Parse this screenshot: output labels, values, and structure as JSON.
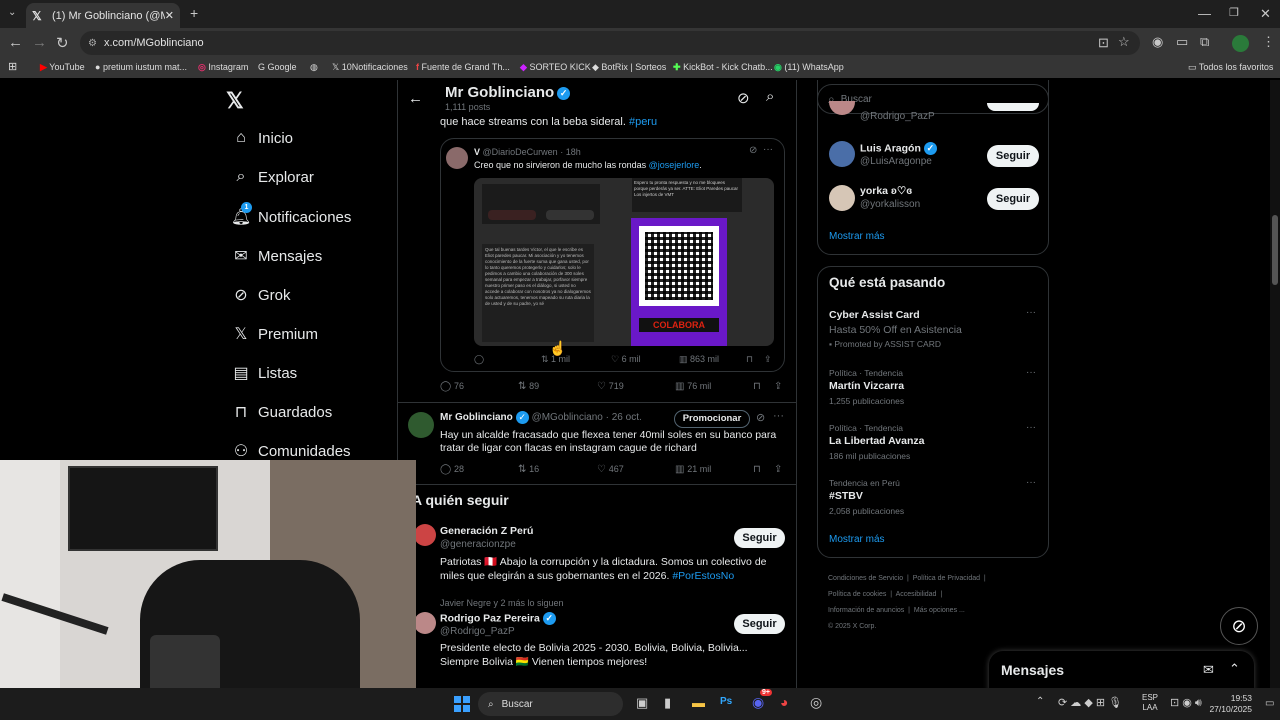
{
  "browser": {
    "tab_title": "(1) Mr Goblinciano (@MGoblinc",
    "url": "x.com/MGoblinciano",
    "bookmarks": [
      "YouTube",
      "pretium iustum mat...",
      "Instagram",
      "Google",
      "10Notificaciones",
      "Fuente de Grand Th...",
      "SORTEO KICK",
      "BotRix | Sorteos",
      "KickBot - Kick Chatb...",
      "(11) WhatsApp"
    ],
    "bookmarks_folder": "Todos los favoritos"
  },
  "nav": {
    "items": [
      "Inicio",
      "Explorar",
      "Notificaciones",
      "Mensajes",
      "Grok",
      "Premium",
      "Listas",
      "Guardados",
      "Comunidades"
    ],
    "notif_badge": "1"
  },
  "profile": {
    "name": "Mr Goblinciano",
    "posts": "1,111 posts"
  },
  "tweet1": {
    "text_tail": "que hace streams con la beba sideral.",
    "hashtag": "#peru",
    "quote": {
      "author": "V",
      "handle": "@DiarioDeCurwen",
      "time": "· 18h",
      "text": "Creo que no sirvieron de mucho las rondas",
      "mention": "@josejerlore",
      "text_end": ".",
      "image_label": "COLABORA",
      "image_note_left": "Que tal buenas tardes Victor, el que le escribe es Eliot paredes paucar. Mi asociación y yo tenemos conocimiento de la fuerte suma que gana usted, por lo tanto queremos protegerlo y cuidarlos; solo le pedimos a cambio una colaboración de 300 soles semanal para empezar a trabajar, porfavor siempre nuestro primer paso es el diálogo, si usted no accede a colaborar con nosotros ya no dialogaremos solo actuaremos, tenemos mapeado su ruta diaria la de usted y de su padre, yo sé",
      "image_note_right": "Espero tu pronta respuesta y no me bloquees porque perderás ya ser. ATTE: Eliot Paredes paucar Los injertos de VMT",
      "stats": {
        "replies": "",
        "retweets": "1 mil",
        "likes": "6 mil",
        "views": "863 mil"
      }
    },
    "stats": {
      "replies": "76",
      "retweets": "89",
      "likes": "719",
      "views": "76 mil"
    }
  },
  "tweet2": {
    "author": "Mr Goblinciano",
    "handle": "@MGoblinciano",
    "time": "· 26 oct.",
    "promote": "Promocionar",
    "text": "Hay un alcalde fracasado que flexea tener 40mil soles en su banco para tratar de ligar con flacas en instagram cague de richard",
    "stats": {
      "replies": "28",
      "retweets": "16",
      "likes": "467",
      "views": "21 mil"
    }
  },
  "who_follow": {
    "title": "A quién seguir",
    "users": [
      {
        "name": "Generación Z Perú",
        "handle": "@generacionzpe",
        "bio": "Patriotas 🇵🇪 Abajo la corrupción y la dictadura. Somos un colectivo de miles que elegirán a sus gobernantes en el 2026.",
        "hashtag": "#PorEstosNo",
        "button": "Seguir"
      },
      {
        "context": "Javier Negre y 2 más lo siguen",
        "name": "Rodrigo Paz Pereira",
        "handle": "@Rodrigo_PazP",
        "bio": "Presidente electo de Bolivia 2025 - 2030. Bolivia, Bolivia, Bolivia... Siempre Bolivia 🇧🇴 Vienen tiempos mejores!",
        "button": "Seguir"
      }
    ]
  },
  "right": {
    "search_placeholder": "Buscar",
    "suggest": [
      {
        "handle": "@Rodrigo_PazP"
      },
      {
        "name": "Luis Aragón",
        "handle": "@LuisAragonpe",
        "button": "Seguir"
      },
      {
        "name": "yorka ʚ♡ɞ",
        "handle": "@yorkalisson",
        "button": "Seguir"
      }
    ],
    "show_more": "Mostrar más",
    "trends_title": "Qué está pasando",
    "trends": [
      {
        "context": "",
        "name": "Cyber Assist Card",
        "sub": "Hasta 50% Off en Asistencia",
        "meta": "Promoted by ASSIST CARD"
      },
      {
        "context": "Política · Tendencia",
        "name": "Martín Vizcarra",
        "meta": "1,255 publicaciones"
      },
      {
        "context": "Política · Tendencia",
        "name": "La Libertad Avanza",
        "meta": "186 mil publicaciones"
      },
      {
        "context": "Tendencia en Perú",
        "name": "#STBV",
        "meta": "2,058 publicaciones"
      }
    ],
    "trends_more": "Mostrar más",
    "footer": [
      "Condiciones de Servicio",
      "Política de Privacidad",
      "Política de cookies",
      "Accesibilidad",
      "Información de anuncios",
      "Más opciones ...",
      "© 2025 X Corp."
    ],
    "messages": "Mensajes"
  },
  "taskbar": {
    "search": "Buscar",
    "lang1": "ESP",
    "lang2": "LAA",
    "time": "19:53",
    "date": "27/10/2025",
    "discord_badge": "9+"
  }
}
